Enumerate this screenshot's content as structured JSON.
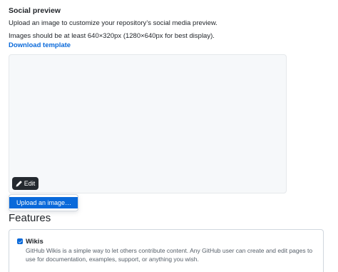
{
  "social_preview": {
    "title": "Social preview",
    "description": "Upload an image to customize your repository’s social media preview.",
    "hint": "Images should be at least 640×320px (1280×640px for best display).",
    "download_label": "Download template"
  },
  "edit_menu": {
    "button_label": "Edit",
    "button_icon": "pencil-icon",
    "items": [
      {
        "label": "Upload an image…"
      }
    ]
  },
  "features": {
    "heading": "Features",
    "wikis": {
      "label": "Wikis",
      "checked": true,
      "description": "GitHub Wikis is a simple way to let others contribute content. Any GitHub user can create and edit pages to use for documentation, examples, support, or anything you wish."
    }
  },
  "colors": {
    "link": "#0969da",
    "button_bg": "#24292f",
    "preview_bg": "#f6f8fa",
    "highlight": "#0969da"
  }
}
